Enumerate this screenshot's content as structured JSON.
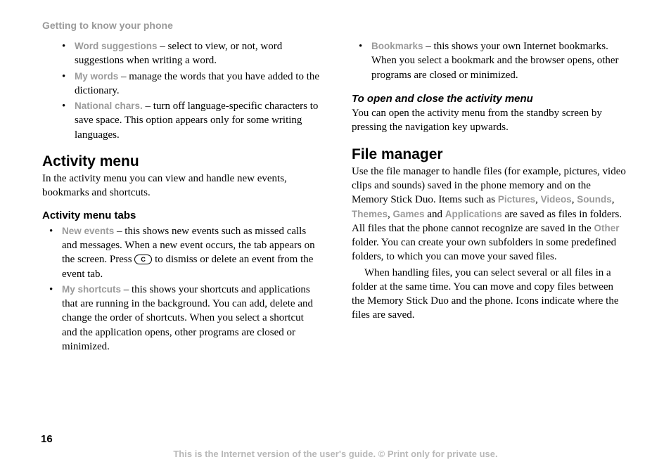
{
  "header": "Getting to know your phone",
  "pagenum": "16",
  "footer": "This is the Internet version of the user's guide. © Print only for private use.",
  "col1": {
    "opts": {
      "word_sugg_label": "Word suggestions",
      "word_sugg_text": " – select to view, or not, word suggestions when writing a word.",
      "my_words_label": "My words",
      "my_words_text": " – manage the words that you have added to the dictionary.",
      "nat_chars_label": "National chars.",
      "nat_chars_text": " – turn off language-specific characters to save space. This option appears only for some writing languages."
    },
    "activity_heading": "Activity menu",
    "activity_intro": "In the activity menu you can view and handle new events, bookmarks and shortcuts.",
    "tabs_heading": "Activity menu tabs",
    "tabs": {
      "new_events_label": "New events",
      "new_events_text1": " – this shows new events such as missed calls and messages. When a new event occurs, the tab appears on the screen. Press ",
      "new_events_key": "C",
      "new_events_text2": " to dismiss or delete an event from the event tab.",
      "my_shortcuts_label": "My shortcuts",
      "my_shortcuts_text": " – this shows your shortcuts and applications that are running in the background. You can add, delete and change the order of shortcuts. When you select a shortcut and the application opens, other programs are closed or minimized."
    }
  },
  "col2": {
    "bookmarks_label": "Bookmarks",
    "bookmarks_text": " – this shows your own Internet bookmarks. When you select a bookmark and the browser opens, other programs are closed or minimized.",
    "open_close_heading": "To open and close the activity menu",
    "open_close_text": "You can open the activity menu from the standby screen by pressing the navigation key upwards.",
    "fm_heading": "File manager",
    "fm_p1a": "Use the file manager to handle files (for example, pictures, video clips and sounds) saved in the phone memory and on the Memory Stick Duo. Items such as ",
    "fm_pictures": "Pictures",
    "fm_sep": ", ",
    "fm_videos": "Videos",
    "fm_sounds": "Sounds",
    "fm_themes": "Themes",
    "fm_games": "Games",
    "fm_and": " and ",
    "fm_applications": "Applications",
    "fm_p1b": " are saved as files in folders. All files that the phone cannot recognize are saved in the ",
    "fm_other": "Other",
    "fm_p1c": " folder. You can create your own subfolders in some predefined folders, to which you can move your saved files.",
    "fm_p2": "When handling files, you can select several or all files in a folder at the same time. You can move and copy files between the Memory Stick Duo and the phone. Icons indicate where the files are saved."
  }
}
